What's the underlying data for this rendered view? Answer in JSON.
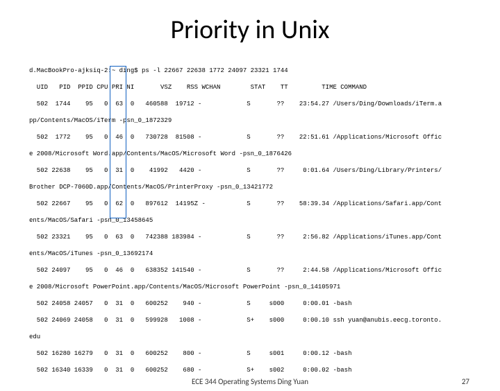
{
  "title": "Priority in Unix",
  "footer": {
    "center": "ECE 344 Operating Systems Ding Yuan",
    "page": "27"
  },
  "terminal": {
    "prompt": "d.MacBookPro-ajksiq-2:~ ding$ ps -l 22667 22638 1772 24097 23321 1744",
    "header": "  UID   PID  PPID CPU PRI NI       VSZ    RSS WCHAN        STAT    TT         TIME COMMAND",
    "lines": [
      "  502  1744    95   0  63  0   460588  19712 -            S       ??    23:54.27 /Users/Ding/Downloads/iTerm.a",
      "pp/Contents/MacOS/iTerm -psn_0_1872329",
      "  502  1772    95   0  46  0   730728  81508 -            S       ??    22:51.61 /Applications/Microsoft Offic",
      "e 2008/Microsoft Word.app/Contents/MacOS/Microsoft Word -psn_0_1876426",
      "  502 22638    95   0  31  0    41992   4420 -            S       ??     0:01.64 /Users/Ding/Library/Printers/",
      "Brother DCP-7060D.app/Contents/MacOS/PrinterProxy -psn_0_13421772",
      "  502 22667    95   0  62  0   897612  14195Z -           S       ??    58:39.34 /Applications/Safari.app/Cont",
      "ents/MacOS/Safari -psn_0_13458645",
      "  502 23321    95   0  63  0   742388 183984 -            S       ??     2:56.82 /Applications/iTunes.app/Cont",
      "ents/MacOS/iTunes -psn_0_13692174",
      "  502 24097    95   0  46  0   638352 141540 -            S       ??     2:44.58 /Applications/Microsoft Offic",
      "e 2008/Microsoft PowerPoint.app/Contents/MacOS/Microsoft PowerPoint -psn_0_14105971",
      "  502 24058 24057   0  31  0   600252    940 -            S     s000     0:00.01 -bash",
      "  502 24069 24058   0  31  0   599928   1008 -            S+    s000     0:00.10 ssh yuan@anubis.eecg.toronto.",
      "edu",
      "  502 16280 16279   0  31  0   600252    800 -            S     s001     0:00.12 -bash",
      "  502 16340 16339   0  31  0   600252    680 -            S+    s002     0:00.02 -bash"
    ]
  },
  "chart_data": {
    "type": "table",
    "title": "ps -l output",
    "columns": [
      "UID",
      "PID",
      "PPID",
      "CPU",
      "PRI",
      "NI",
      "VSZ",
      "RSS",
      "WCHAN",
      "STAT",
      "TT",
      "TIME",
      "COMMAND"
    ],
    "rows": [
      [
        502,
        1744,
        95,
        0,
        63,
        0,
        460588,
        19712,
        "-",
        "S",
        "??",
        "23:54.27",
        "/Users/Ding/Downloads/iTerm.app/Contents/MacOS/iTerm -psn_0_1872329"
      ],
      [
        502,
        1772,
        95,
        0,
        46,
        0,
        730728,
        81508,
        "-",
        "S",
        "??",
        "22:51.61",
        "/Applications/Microsoft Office 2008/Microsoft Word.app/Contents/MacOS/Microsoft Word -psn_0_1876426"
      ],
      [
        502,
        22638,
        95,
        0,
        31,
        0,
        41992,
        4420,
        "-",
        "S",
        "??",
        "0:01.64",
        "/Users/Ding/Library/Printers/Brother DCP-7060D.app/Contents/MacOS/PrinterProxy -psn_0_13421772"
      ],
      [
        502,
        22667,
        95,
        0,
        62,
        0,
        897612,
        141952,
        "-",
        "S",
        "??",
        "58:39.34",
        "/Applications/Safari.app/Contents/MacOS/Safari -psn_0_13458645"
      ],
      [
        502,
        23321,
        95,
        0,
        63,
        0,
        742388,
        183984,
        "-",
        "S",
        "??",
        "2:56.82",
        "/Applications/iTunes.app/Contents/MacOS/iTunes -psn_0_13692174"
      ],
      [
        502,
        24097,
        95,
        0,
        46,
        0,
        638352,
        141540,
        "-",
        "S",
        "??",
        "2:44.58",
        "/Applications/Microsoft Office 2008/Microsoft PowerPoint.app/Contents/MacOS/Microsoft PowerPoint -psn_0_14105971"
      ],
      [
        502,
        24058,
        24057,
        0,
        31,
        0,
        600252,
        940,
        "-",
        "S",
        "s000",
        "0:00.01",
        "-bash"
      ],
      [
        502,
        24069,
        24058,
        0,
        31,
        0,
        599928,
        1008,
        "-",
        "S+",
        "s000",
        "0:00.10",
        "ssh yuan@anubis.eecg.toronto.edu"
      ],
      [
        502,
        16280,
        16279,
        0,
        31,
        0,
        600252,
        800,
        "-",
        "S",
        "s001",
        "0:00.12",
        "-bash"
      ],
      [
        502,
        16340,
        16339,
        0,
        31,
        0,
        600252,
        680,
        "-",
        "S+",
        "s002",
        "0:00.02",
        "-bash"
      ]
    ],
    "highlight_column": "PRI"
  }
}
